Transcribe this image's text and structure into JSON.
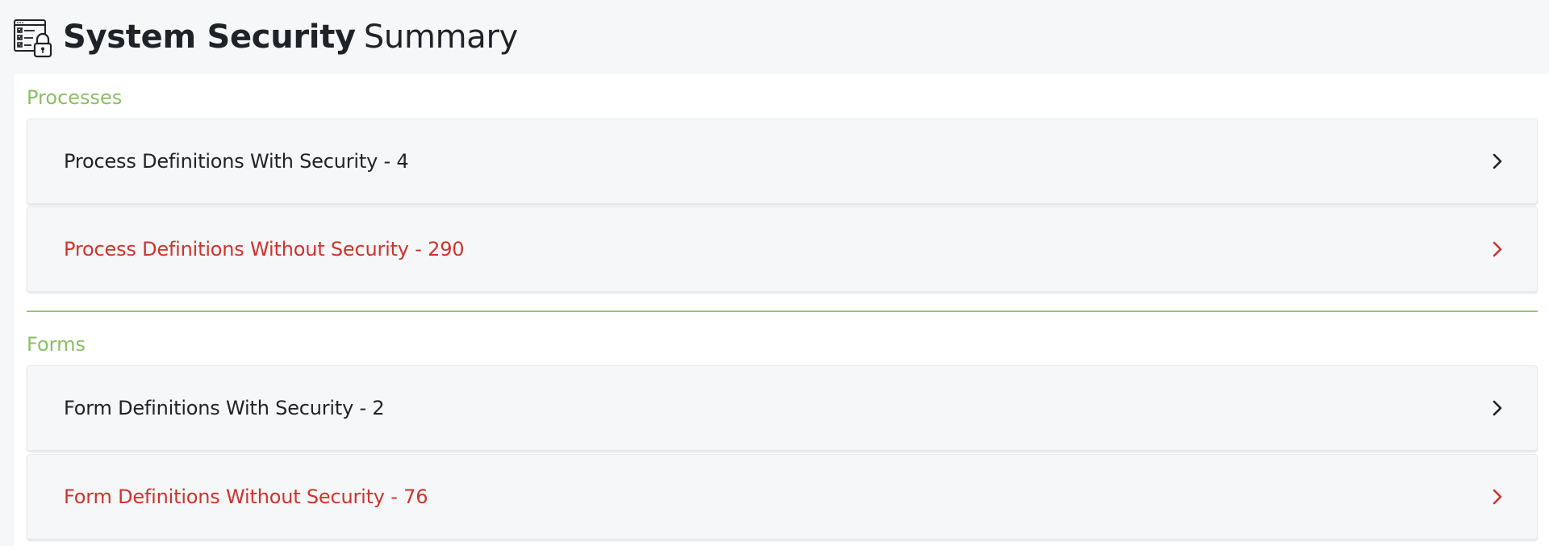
{
  "header": {
    "icon": "checklist-lock-icon",
    "title_strong": "System Security",
    "title_light": "Summary"
  },
  "colors": {
    "section_heading": "#8bbf63",
    "divider": "#98c46e",
    "ok_text": "#1f2327",
    "warn_text": "#d0332b"
  },
  "sections": {
    "processes": {
      "heading": "Processes",
      "items": [
        {
          "label": "Process Definitions With Security - 4",
          "status": "ok",
          "icon": "chevron-right-icon"
        },
        {
          "label": "Process Definitions Without Security - 290",
          "status": "warn",
          "icon": "chevron-right-icon"
        }
      ]
    },
    "forms": {
      "heading": "Forms",
      "items": [
        {
          "label": "Form Definitions With Security - 2",
          "status": "ok",
          "icon": "chevron-right-icon"
        },
        {
          "label": "Form Definitions Without Security - 76",
          "status": "warn",
          "icon": "chevron-right-icon"
        }
      ]
    }
  }
}
